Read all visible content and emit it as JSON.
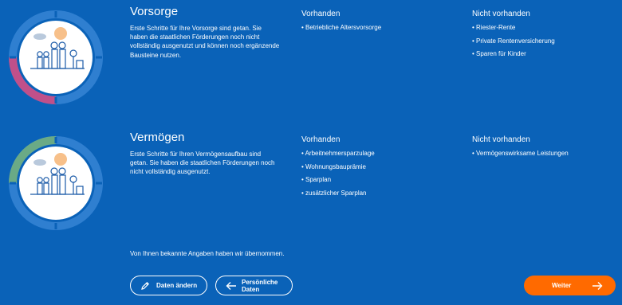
{
  "sections": [
    {
      "title": "Vorsorge",
      "description": "Erste Schritte für Ihre Vorsorge sind getan. Sie haben die staatlichen Förderungen noch nicht vollständig ausgenutzt und können noch ergänzende Bausteine nutzen.",
      "present_heading": "Vorhanden",
      "present_items": [
        "• Betriebliche Altersvorsorge"
      ],
      "missing_heading": "Nicht vorhanden",
      "missing_items": [
        "• Riester-Rente",
        "• Private Rentenversicherung",
        "• Sparen für Kinder"
      ],
      "ring_accent": "#c0508a"
    },
    {
      "title": "Vermögen",
      "description": "Erste Schritte für Ihren Vermögensaufbau sind getan. Sie haben die staatlichen Förderungen noch nicht vollständig ausgenutzt.",
      "present_heading": "Vorhanden",
      "present_items": [
        "• Arbeitnehmersparzulage",
        "• Wohnungsbauprämie",
        "• Sparplan",
        "• zusätzlicher Sparplan"
      ],
      "missing_heading": "Nicht vorhanden",
      "missing_items": [
        "• Vermögenswirksame Leistungen"
      ],
      "ring_accent": "#6aaa86"
    }
  ],
  "note": "Von Ihnen bekannte Angaben haben wir übernommen.",
  "buttons": {
    "edit": "Daten ändern",
    "personal_line1": "Persönliche",
    "personal_line2": "Daten",
    "next": "Weiter"
  },
  "icons": [
    "pencil-icon",
    "arrow-left-icon",
    "arrow-right-icon"
  ],
  "colors": {
    "background": "#0a62b8",
    "primary_button": "#ff6a00",
    "ring_track": "#2f7fd0"
  }
}
